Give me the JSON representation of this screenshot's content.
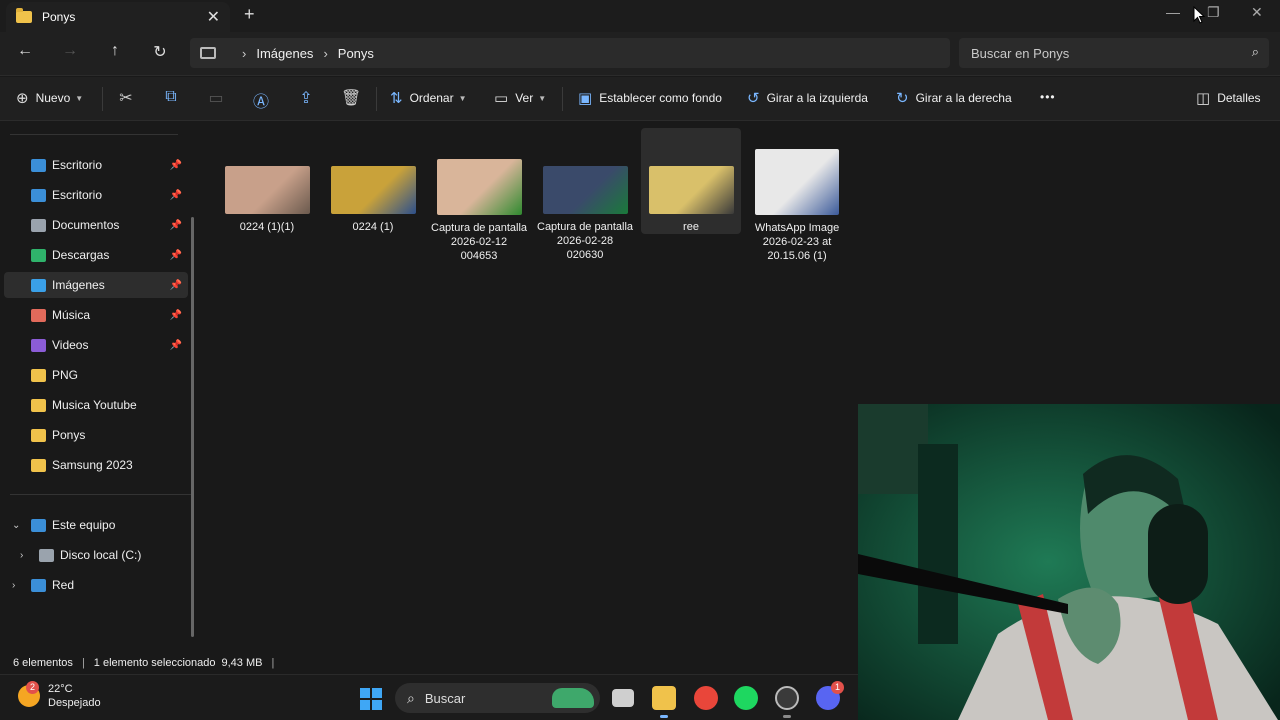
{
  "window": {
    "tab_title": "Ponys",
    "tab_close": "✕",
    "new_tab": "+",
    "controls": {
      "minimize": "—",
      "maximize": "❐",
      "close": "✕"
    }
  },
  "address": {
    "breadcrumb": [
      "Imágenes",
      "Ponys"
    ],
    "separator": "›",
    "search_placeholder": "Buscar en Ponys"
  },
  "toolbar": {
    "new_label": "Nuevo",
    "sort_label": "Ordenar",
    "view_label": "Ver",
    "set_background_label": "Establecer como fondo",
    "rotate_left_label": "Girar a la izquierda",
    "rotate_right_label": "Girar a la derecha",
    "more_label": "•••",
    "details_label": "Detalles"
  },
  "sidebar": {
    "items": [
      {
        "label": "Escritorio",
        "icon": "desktop-icon",
        "color": "#3b8fd8",
        "pinned": true
      },
      {
        "label": "Escritorio",
        "icon": "desktop-icon",
        "color": "#3b8fd8",
        "pinned": true
      },
      {
        "label": "Documentos",
        "icon": "document-icon",
        "color": "#9aa3ad",
        "pinned": true
      },
      {
        "label": "Descargas",
        "icon": "download-icon",
        "color": "#2fb36b",
        "pinned": true
      },
      {
        "label": "Imágenes",
        "icon": "pictures-icon",
        "color": "#3aa0e8",
        "pinned": true,
        "selected": true
      },
      {
        "label": "Música",
        "icon": "music-icon",
        "color": "#e26a5b",
        "pinned": true
      },
      {
        "label": "Videos",
        "icon": "video-icon",
        "color": "#8b5cd6",
        "pinned": true
      },
      {
        "label": "PNG",
        "icon": "folder-icon",
        "color": "#f0c24b"
      },
      {
        "label": "Musica Youtube",
        "icon": "folder-icon",
        "color": "#f0c24b"
      },
      {
        "label": "Ponys",
        "icon": "folder-icon",
        "color": "#f0c24b"
      },
      {
        "label": "Samsung 2023",
        "icon": "folder-icon",
        "color": "#f0c24b"
      }
    ],
    "tree": [
      {
        "label": "Este equipo",
        "expander": "⌄",
        "color": "#3b8fd8"
      },
      {
        "label": "Disco local (C:)",
        "expander": "›",
        "color": "#9aa3ad"
      },
      {
        "label": "Red",
        "expander": "›",
        "color": "#3b8fd8"
      }
    ],
    "pin_glyph": "📌"
  },
  "files": [
    {
      "name": "0224 (1)(1)",
      "colors": [
        "#c8a08a",
        "#6b5a4e"
      ]
    },
    {
      "name": "0224 (1)",
      "colors": [
        "#c9a23a",
        "#2c4f8c"
      ]
    },
    {
      "name": "Captura de pantalla 2026-02-12 004653",
      "colors": [
        "#d9b59a",
        "#2f8a2f"
      ]
    },
    {
      "name": "Captura de pantalla 2026-02-28 020630",
      "colors": [
        "#3a4a6a",
        "#1a7a3a"
      ]
    },
    {
      "name": "ree",
      "colors": [
        "#d9c06a",
        "#3a3a3a"
      ],
      "selected": true
    },
    {
      "name": "WhatsApp Image 2026-02-23 at 20.15.06 (1)",
      "colors": [
        "#e8e8e8",
        "#3b5a9a"
      ]
    }
  ],
  "status": {
    "count": "6 elementos",
    "selection": "1 elemento seleccionado",
    "size": "9,43 MB"
  },
  "taskbar": {
    "weather_temp": "22°C",
    "weather_desc": "Despejado",
    "weather_badge": "2",
    "search_label": "Buscar",
    "discord_badge": "1"
  }
}
